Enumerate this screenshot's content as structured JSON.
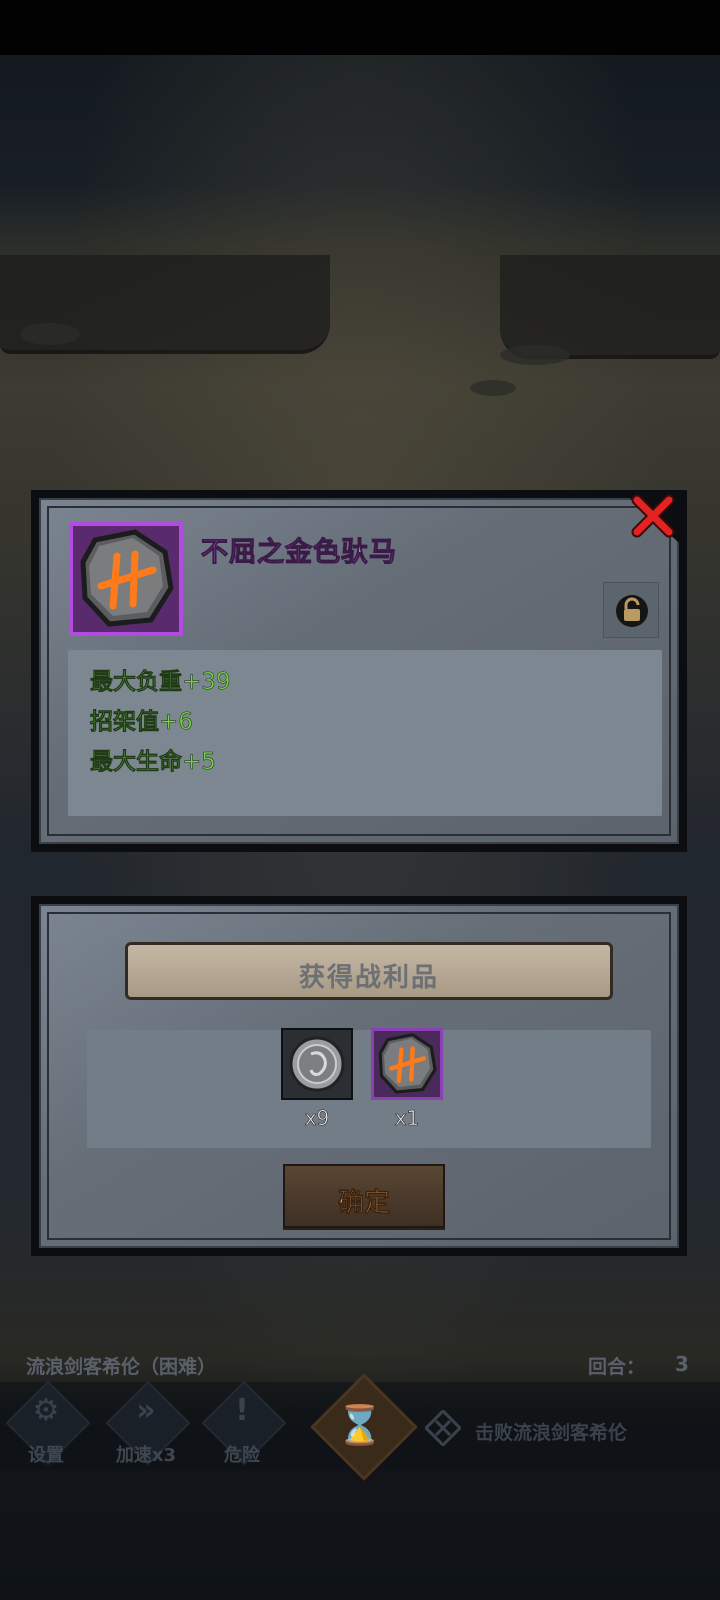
{
  "item_detail": {
    "name": "不屈之金色驮马",
    "stats": [
      {
        "label": "最大负重",
        "value": "+39"
      },
      {
        "label": "招架值",
        "value": "+6"
      },
      {
        "label": "最大生命",
        "value": "+5"
      }
    ],
    "rarity_color": "#b24be0",
    "icons": {
      "item": "rune-stone-icon",
      "lock": "unlock-icon",
      "close": "close-x-icon"
    }
  },
  "loot": {
    "title": "获得战利品",
    "items": [
      {
        "icon": "silver-coin-icon",
        "count": "x9"
      },
      {
        "icon": "rune-stone-icon",
        "count": "x1"
      }
    ],
    "confirm_label": "确定"
  },
  "hud": {
    "boss_name": "流浪剑客希伦（困难）",
    "round_label": "回合：",
    "round_value": "3",
    "buttons": [
      {
        "label": "设置",
        "icon": "gear-icon"
      },
      {
        "label": "加速x3",
        "icon": "fast-forward-icon"
      },
      {
        "label": "危险",
        "icon": "exclamation-icon"
      }
    ],
    "objective": "击败流浪剑客希伦",
    "accent_color": "#e19a4a"
  }
}
